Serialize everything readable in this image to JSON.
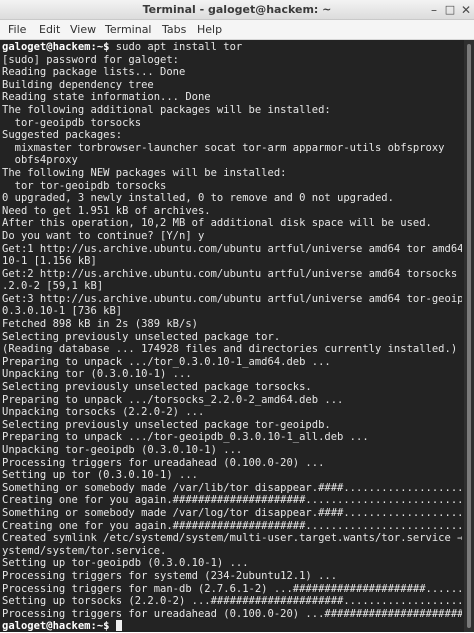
{
  "window": {
    "title": "Terminal - galoget@hackem: ~",
    "minimize_glyph": "–",
    "maximize_glyph": "□",
    "close_glyph": "✕"
  },
  "menu": [
    "File",
    "Edit",
    "View",
    "Terminal",
    "Tabs",
    "Help"
  ],
  "terminal": {
    "prompt_user": "galoget@hackem",
    "prompt_path": ":~$",
    "command": " sudo apt install tor",
    "output": [
      "[sudo] password for galoget:",
      "Reading package lists... Done",
      "Building dependency tree",
      "Reading state information... Done",
      "The following additional packages will be installed:",
      "  tor-geoipdb torsocks",
      "Suggested packages:",
      "  mixmaster torbrowser-launcher socat tor-arm apparmor-utils obfsproxy",
      "  obfs4proxy",
      "The following NEW packages will be installed:",
      "  tor tor-geoipdb torsocks",
      "0 upgraded, 3 newly installed, 0 to remove and 0 not upgraded.",
      "Need to get 1.951 kB of archives.",
      "After this operation, 10,2 MB of additional disk space will be used.",
      "Do you want to continue? [Y/n] y",
      "Get:1 http://us.archive.ubuntu.com/ubuntu artful/universe amd64 tor amd64 0.3.0.",
      "10-1 [1.156 kB]",
      "Get:2 http://us.archive.ubuntu.com/ubuntu artful/universe amd64 torsocks amd64 2",
      ".2.0-2 [59,1 kB]",
      "Get:3 http://us.archive.ubuntu.com/ubuntu artful/universe amd64 tor-geoipdb all",
      "0.3.0.10-1 [736 kB]",
      "Fetched 898 kB in 2s (389 kB/s)",
      "Selecting previously unselected package tor.",
      "(Reading database ... 174928 files and directories currently installed.)",
      "Preparing to unpack .../tor_0.3.0.10-1_amd64.deb ...",
      "Unpacking tor (0.3.0.10-1) ...",
      "Selecting previously unselected package torsocks.",
      "Preparing to unpack .../torsocks_2.2.0-2_amd64.deb ...",
      "Unpacking torsocks (2.2.0-2) ...",
      "Selecting previously unselected package tor-geoipdb.",
      "Preparing to unpack .../tor-geoipdb_0.3.0.10-1_all.deb ...",
      "Unpacking tor-geoipdb (0.3.0.10-1) ...",
      "Processing triggers for ureadahead (0.100.0-20) ...",
      "Setting up tor (0.3.0.10-1) ...",
      "Something or somebody made /var/lib/tor disappear.####..........................",
      "Creating one for you again.#####################............................",
      "Something or somebody made /var/log/tor disappear.####..........................",
      "Creating one for you again.#####################............................",
      "Created symlink /etc/systemd/system/multi-user.target.wants/tor.service → /lib/s",
      "ystemd/system/tor.service.",
      "Setting up tor-geoipdb (0.3.0.10-1) ...",
      "Processing triggers for systemd (234-2ubuntu12.1) ...",
      "Processing triggers for man-db (2.7.6.1-2) ...#####################.............",
      "Setting up torsocks (2.2.0-2) ...#####################.........................",
      "Processing triggers for ureadahead (0.100.0-20) ...######################.......",
      "  "
    ]
  }
}
